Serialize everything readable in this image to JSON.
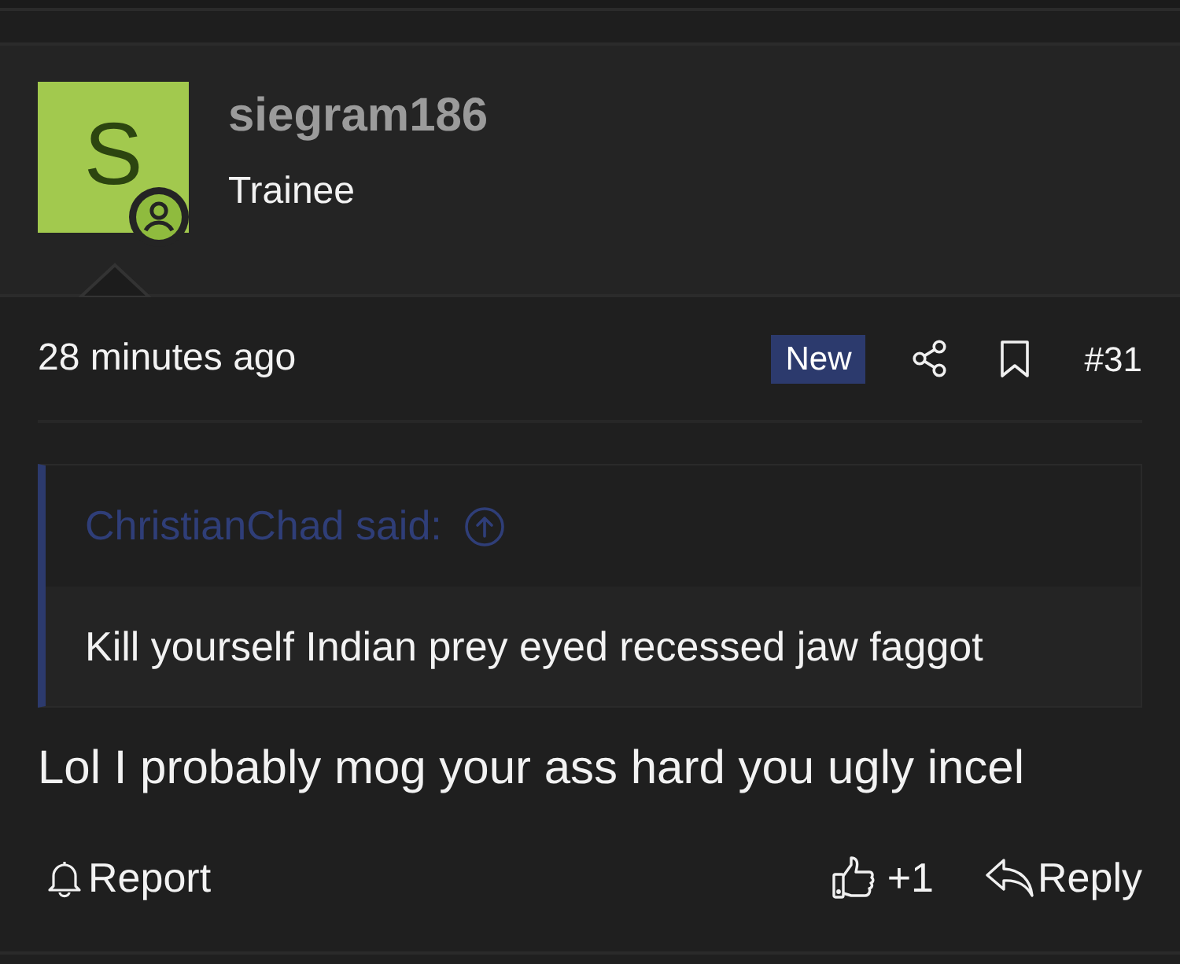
{
  "user": {
    "avatar_letter": "S",
    "username": "siegram186",
    "title": "Trainee"
  },
  "post_meta": {
    "time": "28 minutes ago",
    "badge": "New",
    "post_number": "#31"
  },
  "quote": {
    "author_line": "ChristianChad said:",
    "text": "Kill yourself Indian prey eyed recessed jaw faggot"
  },
  "message": "Lol I probably mog your ass hard you ugly incel",
  "actions": {
    "report": "Report",
    "reactions": "+1",
    "reply": "Reply"
  }
}
